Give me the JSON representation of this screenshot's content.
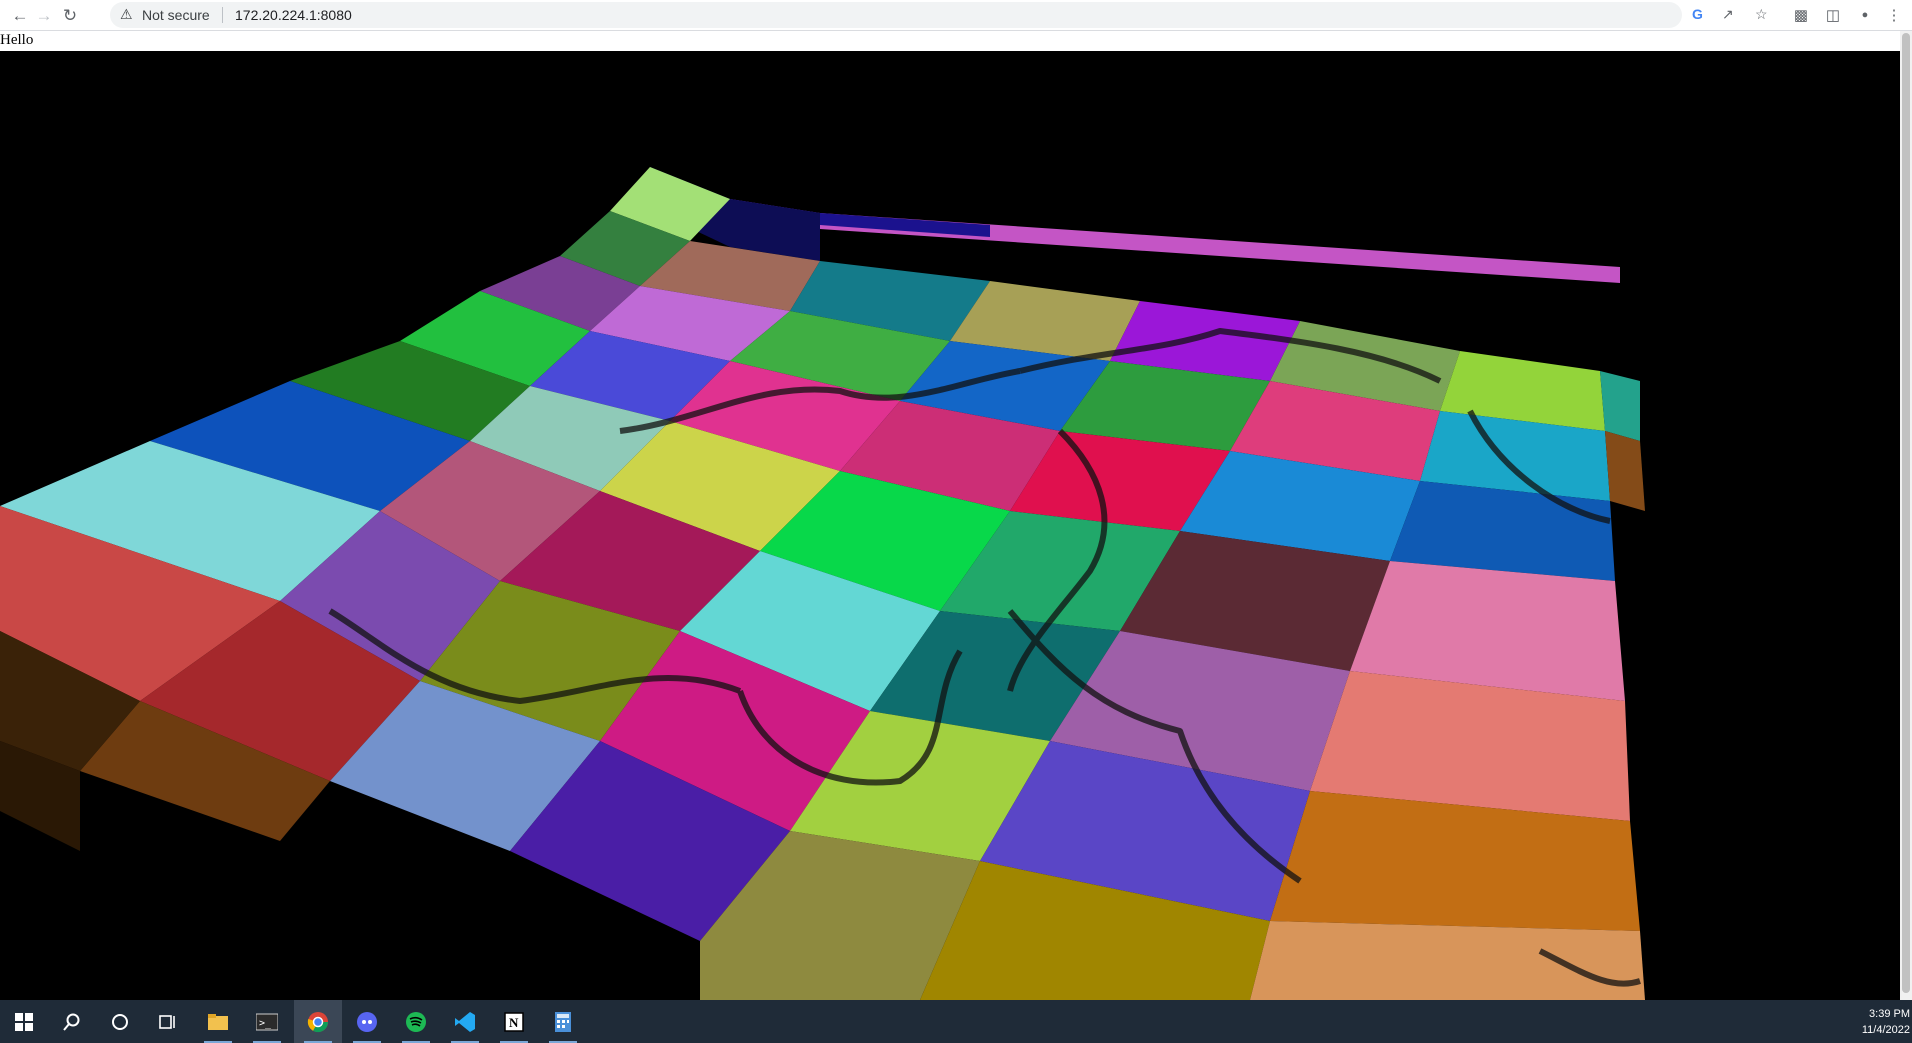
{
  "browser": {
    "security_label": "Not secure",
    "url": "172.20.224.1:8080",
    "nav": {
      "back": "back-arrow-icon",
      "forward": "forward-arrow-icon",
      "reload": "reload-icon"
    },
    "omnibox_icons": [
      "google-icon",
      "share-icon",
      "bookmark-star-icon"
    ],
    "toolbar_icons": [
      "extensions-icon",
      "side-panel-icon",
      "profile-icon",
      "menu-icon"
    ]
  },
  "page": {
    "heading": "Hello",
    "scene_description_colors": {
      "background": "#000000"
    }
  },
  "taskbar": {
    "apps": [
      "windows-start-icon",
      "search-icon",
      "cortana-icon",
      "task-view-icon",
      "file-explorer-icon",
      "terminal-icon",
      "chrome-icon",
      "discord-icon",
      "spotify-icon",
      "vscode-icon",
      "notion-icon",
      "calculator-icon"
    ],
    "time": "3:39 PM",
    "date": "11/4/2022"
  }
}
